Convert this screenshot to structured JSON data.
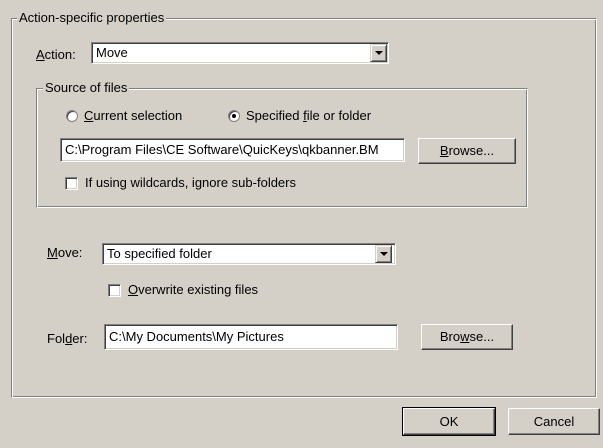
{
  "group_main": {
    "legend": "Action-specific properties"
  },
  "action": {
    "label_u": "A",
    "label_rest": "ction:",
    "value": "Move"
  },
  "source": {
    "legend": "Source of files",
    "radio_current_u": "C",
    "radio_current_rest": "urrent selection",
    "radio_current_selected": false,
    "radio_specified_pre": "Specified ",
    "radio_specified_u": "f",
    "radio_specified_rest": "ile or folder",
    "radio_specified_selected": true,
    "path_value": "C:\\Program Files\\CE Software\\QuicKeys\\qkbanner.BM",
    "browse_u": "B",
    "browse_rest": "rowse...",
    "wildcards_label": "If using wildcards, ignore sub-folders",
    "wildcards_checked": false
  },
  "move": {
    "label_u": "M",
    "label_rest": "ove:",
    "value": "To specified folder",
    "overwrite_u": "O",
    "overwrite_rest": "verwrite existing files",
    "overwrite_checked": false
  },
  "folder": {
    "label_pre": "Fol",
    "label_u": "d",
    "label_rest": "er:",
    "value": "C:\\My Documents\\My Pictures",
    "browse_pre": "Bro",
    "browse_u": "w",
    "browse_rest": "se..."
  },
  "footer": {
    "ok_label": "OK",
    "cancel_label": "Cancel"
  }
}
